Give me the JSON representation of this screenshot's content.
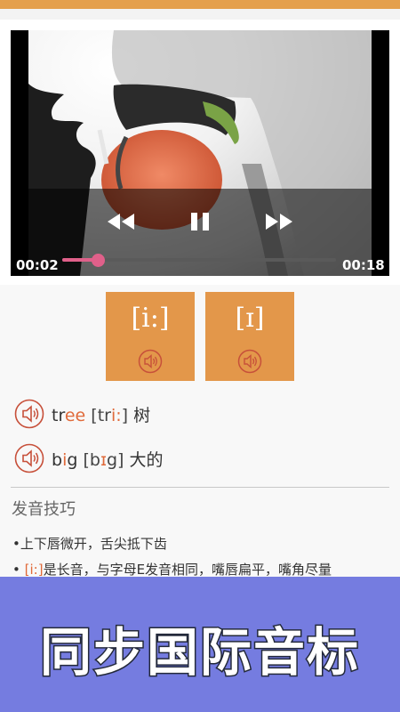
{
  "video": {
    "current_time": "00:02",
    "duration": "00:18",
    "progress": 0.13,
    "icons": [
      "rewind-icon",
      "pause-icon",
      "fast-forward-icon"
    ]
  },
  "phonemes": [
    {
      "symbol": "[i:]",
      "icon": "speaker-icon"
    },
    {
      "symbol": "[ɪ]",
      "icon": "speaker-icon"
    }
  ],
  "words": [
    {
      "word_pre": "tr",
      "word_hl": "ee",
      "word_post": "",
      "pron_pre": "[tr",
      "pron_hl": "i:",
      "pron_post": "]",
      "meaning": "树",
      "icon": "speaker-icon"
    },
    {
      "word_pre": "b",
      "word_hl": "i",
      "word_post": "g",
      "pron_pre": "[b",
      "pron_hl": "ɪ",
      "pron_post": "g]",
      "meaning": "大的",
      "icon": "speaker-icon"
    }
  ],
  "tips": {
    "title": "发音技巧",
    "items": [
      {
        "prefix": "•上下唇微开，舌尖抵下齿",
        "hl": "",
        "rest": ""
      },
      {
        "prefix": "• ",
        "hl": "[i:]",
        "rest": "是长音，与字母E发音相同，嘴唇扁平，嘴角尽量"
      }
    ]
  },
  "banner": {
    "text": "同步国际音标"
  },
  "colors": {
    "accent": "#e3974a",
    "highlight": "#e06a3a",
    "progress": "#e0608a",
    "banner": "#757ce0"
  }
}
